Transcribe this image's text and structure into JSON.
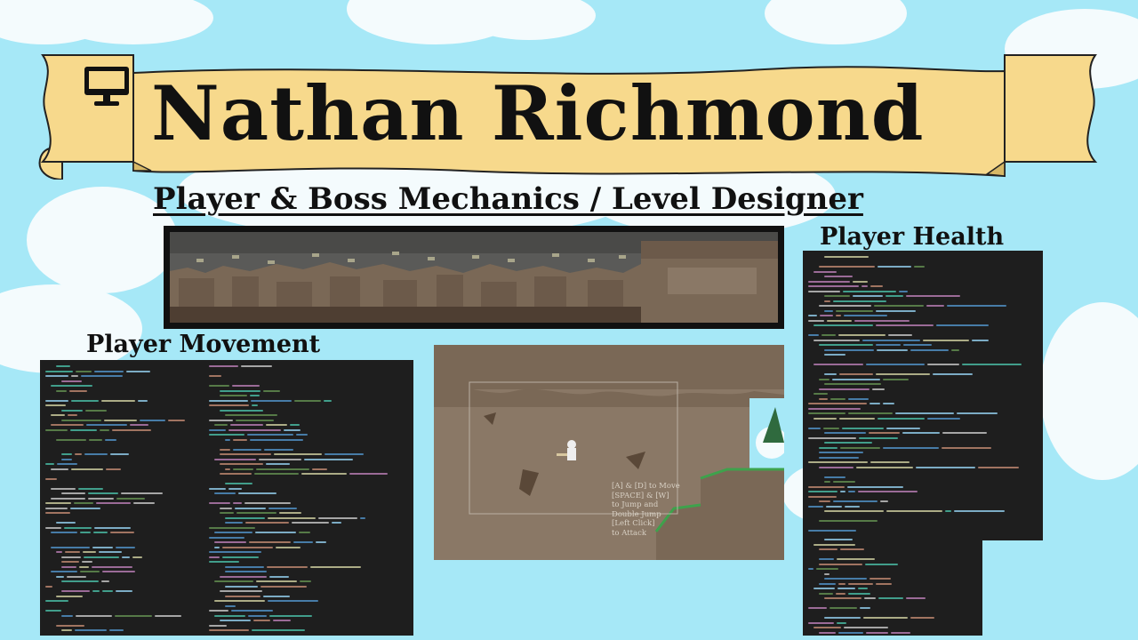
{
  "header": {
    "name": "Nathan Richmond",
    "subtitle": "Player & Boss Mechanics / Level Designer"
  },
  "sections": {
    "player_health_label": "Player Health",
    "player_movement_label": "Player Movement"
  },
  "game": {
    "controls_text": "[A] & [D] to Move\n[SPACE] & [W]\nto Jump and\nDouble Jump\n[Left Click]\nto Attack"
  },
  "icons": {
    "banner_icon": "monitor-icon"
  },
  "colors": {
    "sky": "#a6e8f7",
    "banner": "#f7d98c",
    "code_bg": "#1e1e1e",
    "dirt": "#7a6856",
    "grass": "#3ea24c"
  }
}
